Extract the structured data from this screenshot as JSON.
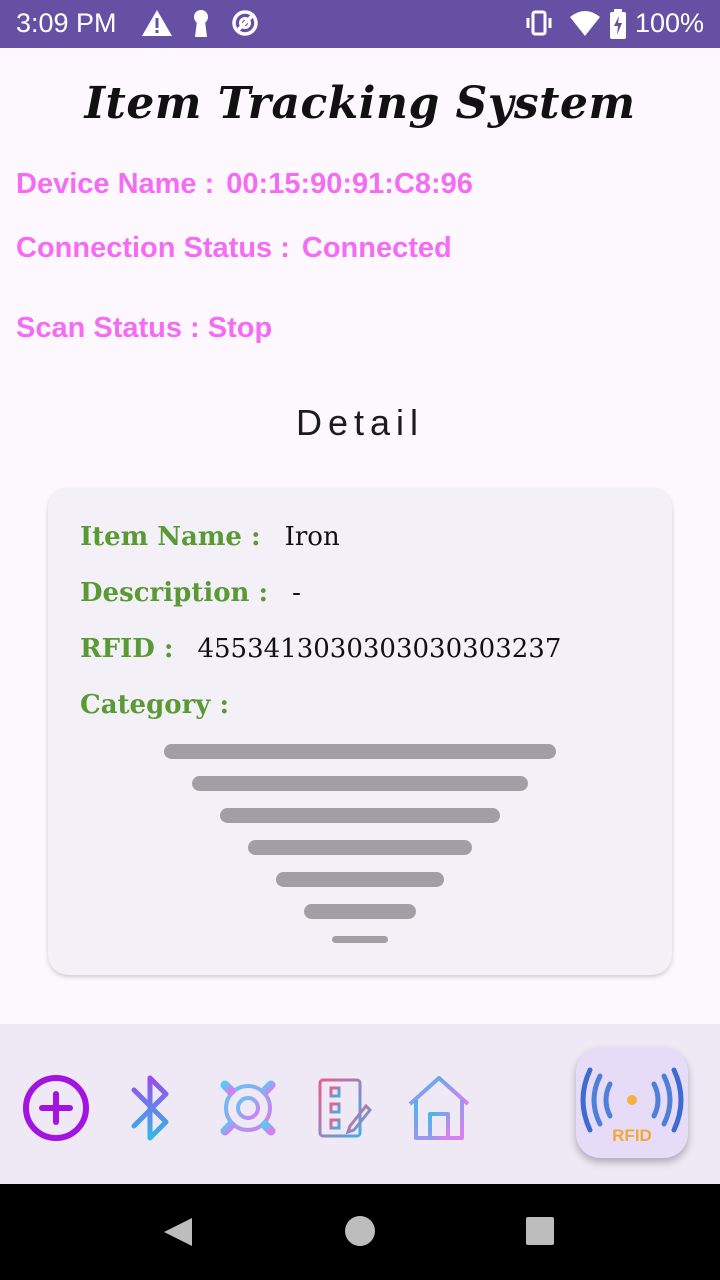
{
  "status_bar": {
    "time": "3:09 PM",
    "battery": "100%",
    "left_icons": [
      "alert-icon",
      "keyhole-icon",
      "no-data-icon"
    ],
    "right_icons": [
      "vibrate-icon",
      "wifi-icon",
      "battery-icon"
    ]
  },
  "header": {
    "title": "Item Tracking System"
  },
  "device": {
    "name_label": "Device Name :",
    "name_value": "00:15:90:91:C8:96",
    "connection_label": "Connection Status :",
    "connection_value": "Connected",
    "scan_label": "Scan Status :",
    "scan_value": "Stop"
  },
  "detail": {
    "heading": "Detail",
    "fields": [
      {
        "label": "Item Name :",
        "value": "Iron"
      },
      {
        "label": "Description :",
        "value": "-"
      },
      {
        "label": "RFID :",
        "value": "4553413030303030303237"
      },
      {
        "label": "Category :",
        "value": ""
      }
    ]
  },
  "bottom_nav": {
    "items": [
      "add-icon",
      "bluetooth-icon",
      "settings-icon",
      "report-icon",
      "home-icon"
    ],
    "fab_label": "RFID"
  },
  "colors": {
    "status_bar": "#6650a4",
    "info_text": "#f36cf3",
    "field_label": "#5a9a35",
    "card_bg": "#f4f0f7",
    "nav_bg": "#efe8f5",
    "fab_bg": "#e7dcf7",
    "add_icon": "#a414e0"
  }
}
